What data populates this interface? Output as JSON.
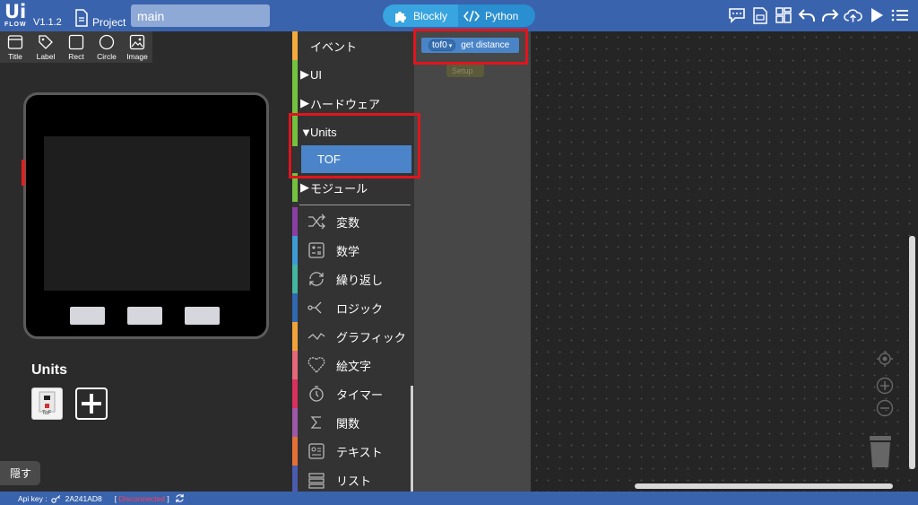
{
  "app": {
    "logo_text": "Ui",
    "logo_subtext": "FLOW",
    "version": "V1.1.2",
    "project_label": "Project",
    "file_name": "main"
  },
  "mode_switch": {
    "blockly_label": "Blockly",
    "python_label": "Python"
  },
  "top_icons": [
    "chat-icon",
    "firmware-icon",
    "layout-icon",
    "undo-icon",
    "redo-icon",
    "cloud-upload-icon",
    "run-icon",
    "menu-icon"
  ],
  "ui_tools": [
    {
      "label": "Title",
      "icon": "title-icon"
    },
    {
      "label": "Label",
      "icon": "label-icon"
    },
    {
      "label": "Rect",
      "icon": "rect-icon"
    },
    {
      "label": "Circle",
      "icon": "circle-icon"
    },
    {
      "label": "Image",
      "icon": "image-icon"
    }
  ],
  "units_panel": {
    "title": "Units",
    "unit_caption": "ToF",
    "hide_label": "隠す"
  },
  "categories": [
    {
      "label": "イベント",
      "color": "#f3a93c"
    },
    {
      "label": "UI",
      "color": "#74c13f"
    },
    {
      "label": "ハードウェア",
      "color": "#74c13f"
    },
    {
      "label": "Units",
      "color": "#74c13f"
    },
    {
      "label": "TOF",
      "color": "#4b84c9"
    },
    {
      "label": "モジュール",
      "color": "#74c13f"
    },
    {
      "label": "変数",
      "color": "#8a3ea4"
    },
    {
      "label": "数学",
      "color": "#3d9ad6"
    },
    {
      "label": "繰り返し",
      "color": "#43b5a0"
    },
    {
      "label": "ロジック",
      "color": "#3068b0"
    },
    {
      "label": "グラフィック",
      "color": "#f1a33a"
    },
    {
      "label": "絵文字",
      "color": "#e56879"
    },
    {
      "label": "タイマー",
      "color": "#d8305f"
    },
    {
      "label": "関数",
      "color": "#9d58a8"
    },
    {
      "label": "テキスト",
      "color": "#e57036"
    },
    {
      "label": "リスト",
      "color": "#4a5cad"
    }
  ],
  "block": {
    "dropdown": "tof0",
    "text": "get distance"
  },
  "setup_block": {
    "text": "Setup"
  },
  "status": {
    "api_label": "Api key :",
    "api_key": "2A241AD8",
    "connection": "Disconnected"
  }
}
